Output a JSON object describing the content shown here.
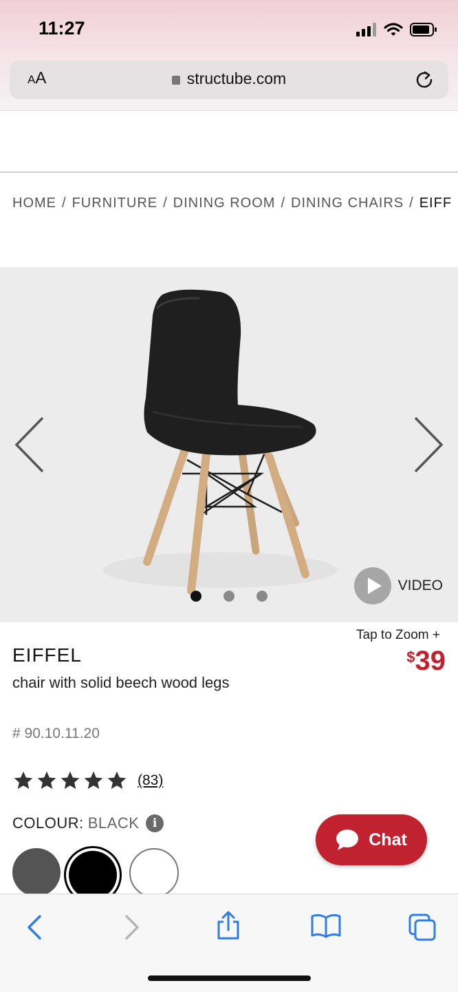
{
  "status_bar": {
    "time": "11:27"
  },
  "browser": {
    "text_size_label": "AA",
    "url_host": "structube.com"
  },
  "breadcrumb": {
    "items": [
      "HOME",
      "FURNITURE",
      "DINING ROOM",
      "DINING CHAIRS"
    ],
    "current": "EIFF",
    "separator": "/"
  },
  "gallery": {
    "video_label": "VIDEO",
    "slide_count": 3,
    "active_slide": 1
  },
  "product": {
    "tap_to_zoom": "Tap to Zoom +",
    "name": "EIFFEL",
    "description": "chair with solid beech wood legs",
    "sku": "# 90.10.11.20",
    "price_currency": "$",
    "price_value": "39",
    "rating_stars": 5,
    "review_count": "(83)",
    "colour_label": "COLOUR:",
    "colour_value": "BLACK",
    "swatches": [
      "dark grey",
      "black",
      "white"
    ],
    "selected_swatch": "black"
  },
  "chat": {
    "label": "Chat"
  },
  "colors": {
    "accent_red": "#c0232f",
    "ios_blue": "#2f7de1",
    "chair_black": "#1a1a1a",
    "wood": "#caa57a"
  },
  "toolbar": {
    "icons": [
      "back-icon",
      "forward-icon",
      "share-icon",
      "bookmarks-icon",
      "tabs-icon"
    ]
  }
}
